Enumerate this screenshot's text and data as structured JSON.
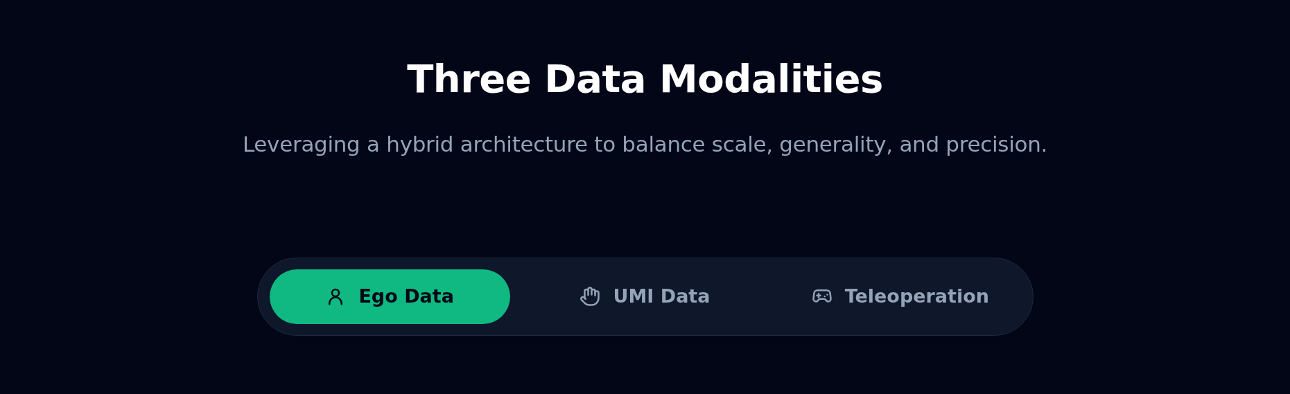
{
  "heading": "Three Data Modalities",
  "subtitle": "Leveraging a hybrid architecture to balance scale, generality, and precision.",
  "tabs": [
    {
      "label": "Ego Data",
      "kind": "person",
      "selected": true
    },
    {
      "label": "UMI Data",
      "kind": "hand",
      "selected": false
    },
    {
      "label": "Teleoperation",
      "kind": "gamepad",
      "selected": false
    }
  ]
}
